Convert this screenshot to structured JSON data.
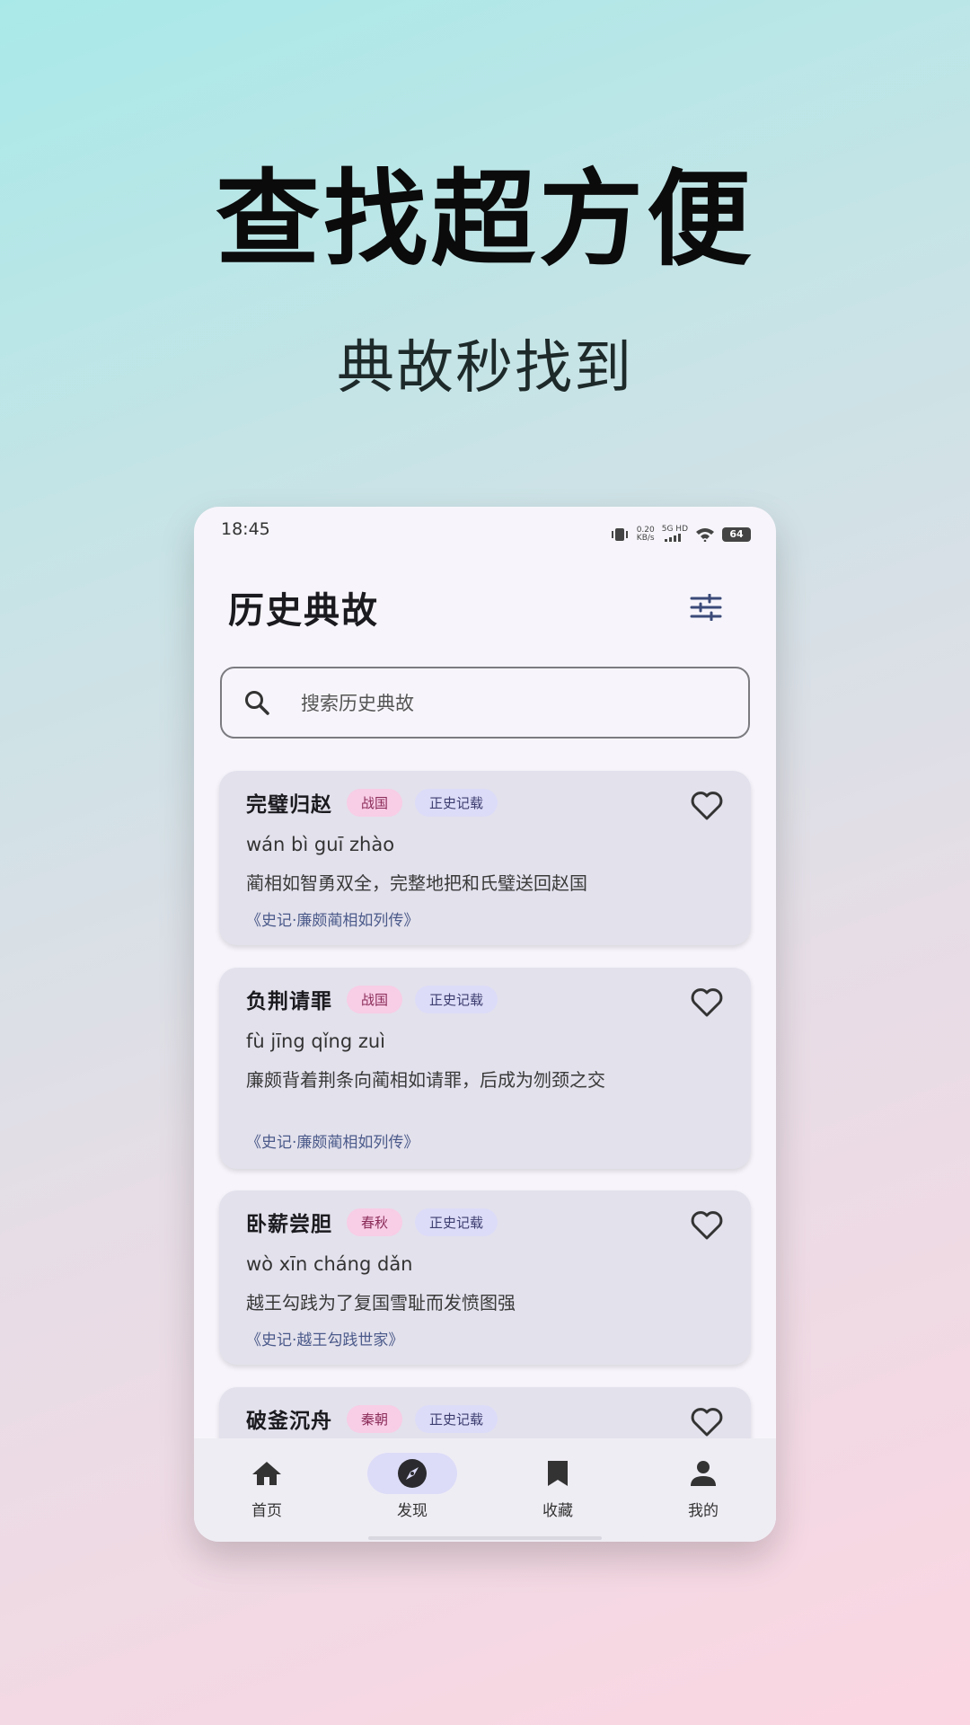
{
  "promo": {
    "headline": "查找超方便",
    "subline": "典故秒找到"
  },
  "statusbar": {
    "time": "18:45",
    "net_speed_value": "0.20",
    "net_speed_unit": "KB/s",
    "network": "5G HD",
    "battery": "64"
  },
  "appbar": {
    "title": "历史典故"
  },
  "search": {
    "placeholder": "搜索历史典故"
  },
  "cards": [
    {
      "name": "完璧归赵",
      "era": "战国",
      "source_type": "正史记载",
      "pinyin": "wán bì guī zhào",
      "desc": "蔺相如智勇双全，完整地把和氏璧送回赵国",
      "source": "《史记·廉颇蔺相如列传》"
    },
    {
      "name": "负荆请罪",
      "era": "战国",
      "source_type": "正史记载",
      "pinyin": "fù jīng qǐng zuì",
      "desc": "廉颇背着荆条向蔺相如请罪，后成为刎颈之交",
      "source": "《史记·廉颇蔺相如列传》"
    },
    {
      "name": "卧薪尝胆",
      "era": "春秋",
      "source_type": "正史记载",
      "pinyin": "wò xīn cháng dǎn",
      "desc": "越王勾践为了复国雪耻而发愤图强",
      "source": "《史记·越王勾践世家》"
    },
    {
      "name": "破釜沉舟",
      "era": "秦朝",
      "source_type": "正史记载"
    }
  ],
  "nav": {
    "items": [
      {
        "label": "首页",
        "icon": "home-icon"
      },
      {
        "label": "发现",
        "icon": "compass-icon",
        "active": true
      },
      {
        "label": "收藏",
        "icon": "bookmark-icon"
      },
      {
        "label": "我的",
        "icon": "person-icon"
      }
    ]
  },
  "colors": {
    "era_tag_bg": "#f8cde6",
    "source_tag_bg": "#dcdcf8",
    "card_bg": "#e3e1ec",
    "active_nav_bg": "#dcdcf8"
  }
}
